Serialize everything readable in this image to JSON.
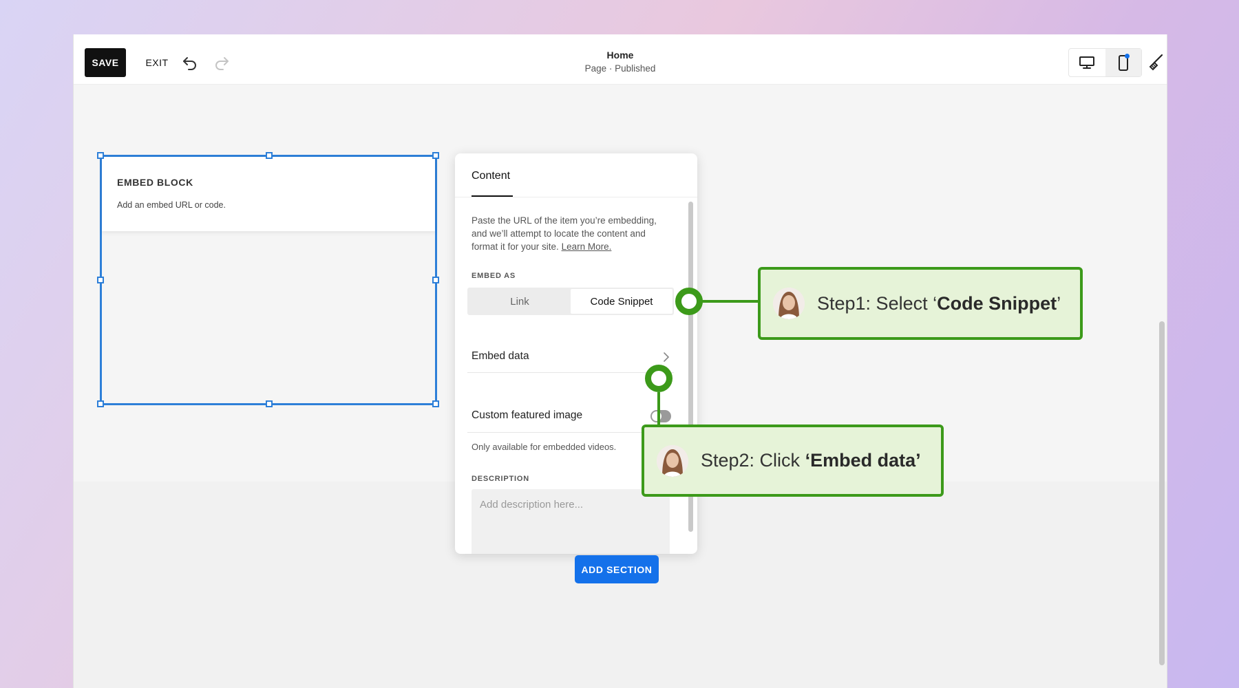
{
  "toolbar": {
    "save_label": "SAVE",
    "exit_label": "EXIT",
    "undo_icon": "undo-icon",
    "redo_icon": "redo-icon"
  },
  "page": {
    "title": "Home",
    "subtitle": "Page · Published"
  },
  "view_toggle": {
    "desktop_icon": "desktop-icon",
    "mobile_icon": "mobile-icon",
    "active": "mobile"
  },
  "embed_block": {
    "title": "EMBED BLOCK",
    "subtitle": "Add an embed URL or code."
  },
  "panel": {
    "tab": "Content",
    "description_text": "Paste the URL of the item you’re embedding, and we’ll attempt to locate the content and format it for your site.",
    "learn_more": "Learn More.",
    "embed_as_label": "EMBED AS",
    "options": [
      "Link",
      "Code Snippet"
    ],
    "selected_option": "Code Snippet",
    "embed_data_label": "Embed data",
    "custom_image_label": "Custom featured image",
    "custom_image_enabled": false,
    "custom_image_hint": "Only available for embedded videos.",
    "description_label": "DESCRIPTION",
    "description_placeholder": "Add description here..."
  },
  "add_section_label": "ADD SECTION",
  "callouts": {
    "step1_prefix": "Step1: Select ‘",
    "step1_bold": "Code Snippet",
    "step1_suffix": "’",
    "step2_prefix": "Step2: Click ",
    "step2_bold": "‘Embed data’",
    "accent_color": "#3c9a1a",
    "fill_color": "#e6f3d8"
  }
}
